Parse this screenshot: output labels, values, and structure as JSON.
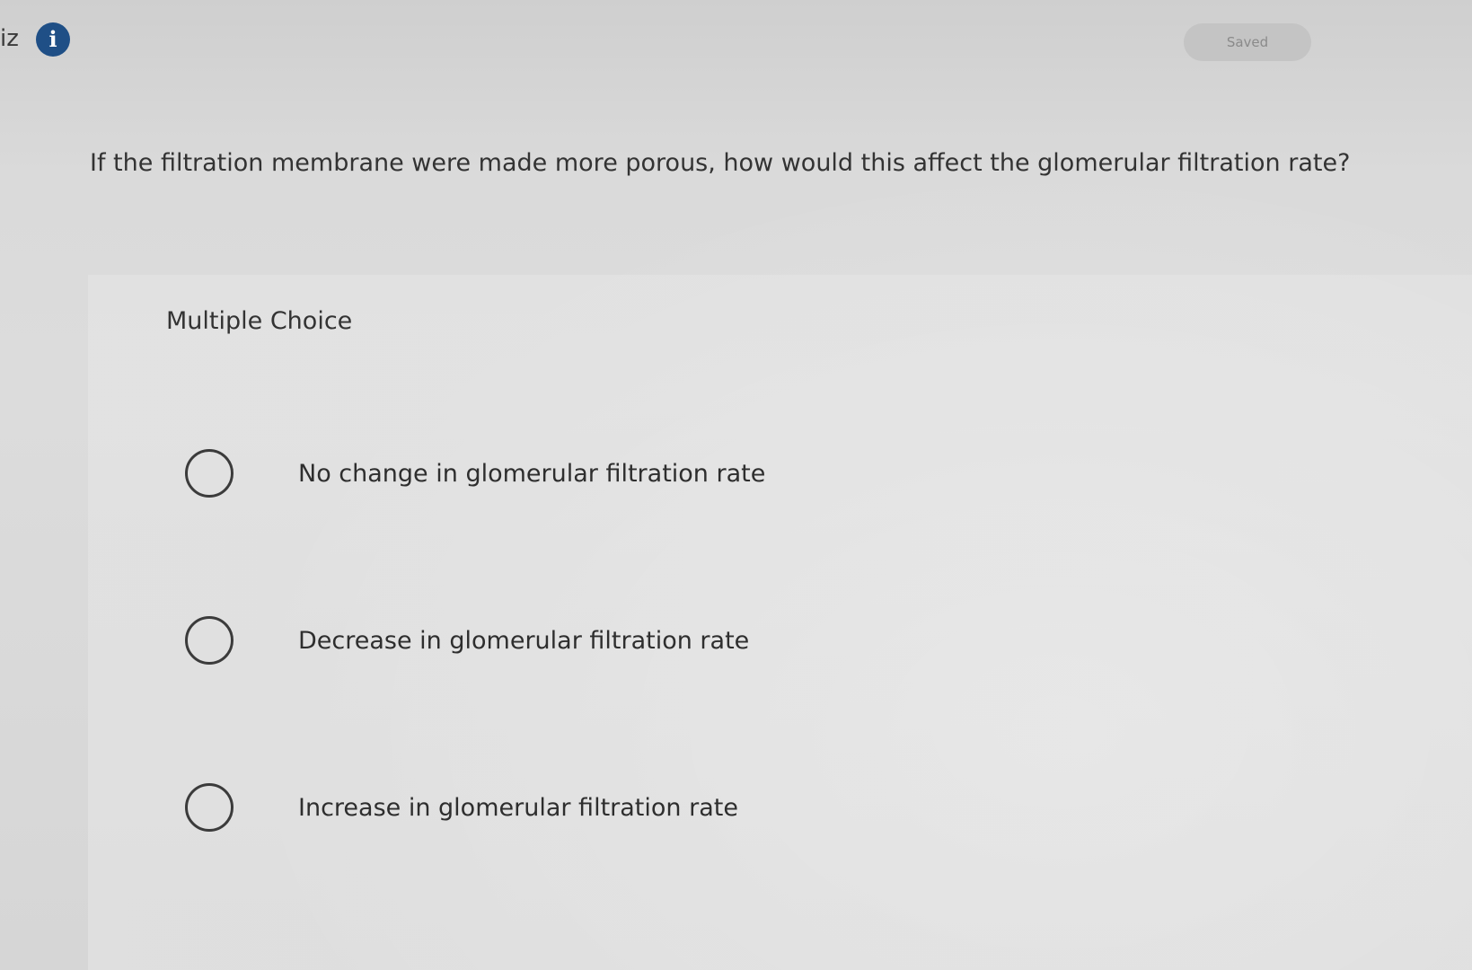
{
  "header": {
    "quiz_label": "iz",
    "info_icon": "info-icon",
    "saved_label": "Saved"
  },
  "question": {
    "text": "If the filtration membrane were made more porous, how would this affect the glomerular filtration rate?"
  },
  "answer_section": {
    "type_label": "Multiple Choice",
    "choices": [
      {
        "label": "No change in glomerular filtration rate",
        "selected": false
      },
      {
        "label": "Decrease in glomerular filtration rate",
        "selected": false
      },
      {
        "label": "Increase in glomerular filtration rate",
        "selected": false
      }
    ]
  },
  "colors": {
    "info_icon": "#1f4f86",
    "background": "#d8d8d8"
  }
}
